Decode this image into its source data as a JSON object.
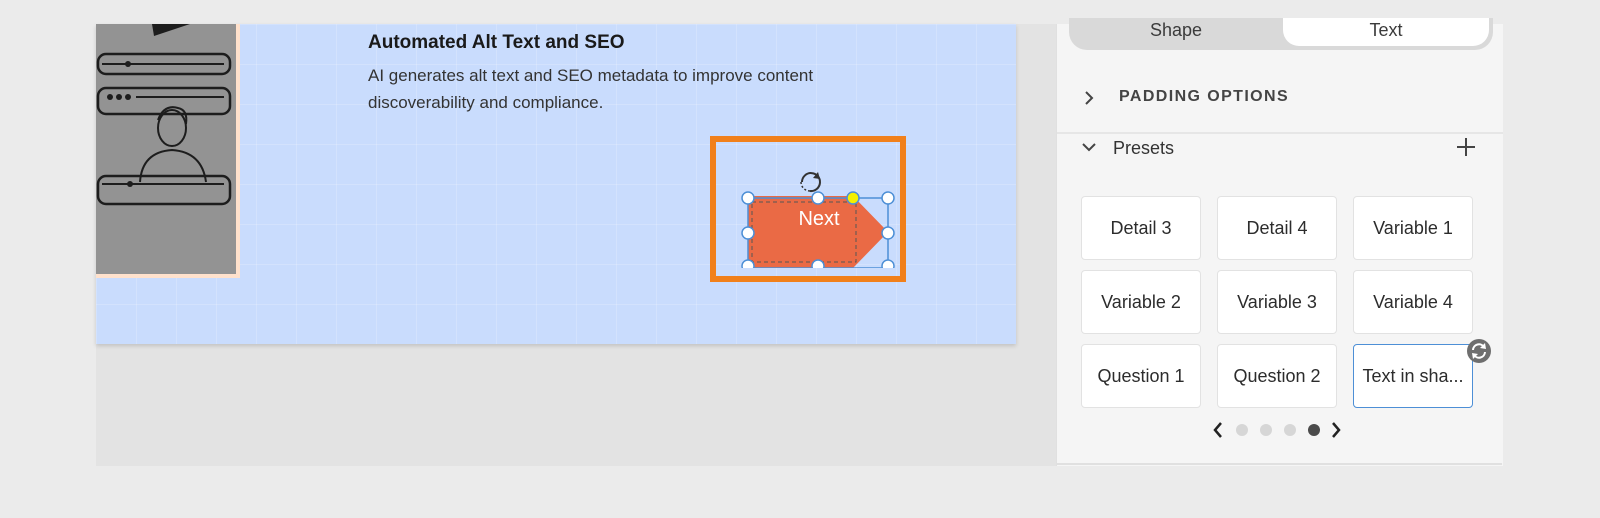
{
  "slide": {
    "title": "Automated Alt Text and SEO",
    "description": "AI generates alt text and SEO metadata to improve content discoverability and compliance.",
    "shape_label": "Next"
  },
  "panel": {
    "toggle": {
      "shape": "Shape",
      "text": "Text"
    },
    "padding_options": "PADDING OPTIONS",
    "presets_label": "Presets",
    "presets": [
      "Detail 3",
      "Detail 4",
      "Variable 1",
      "Variable 2",
      "Variable 3",
      "Variable 4",
      "Question 1",
      "Question 2",
      "Text in sha..."
    ],
    "selected_preset_index": 8,
    "pager": {
      "total": 4,
      "current": 4
    }
  },
  "colors": {
    "slide_bg": "#c9dcfd",
    "highlight": "#f1801b",
    "shape_fill": "#ea6a45",
    "selection": "#4d8fd6"
  }
}
